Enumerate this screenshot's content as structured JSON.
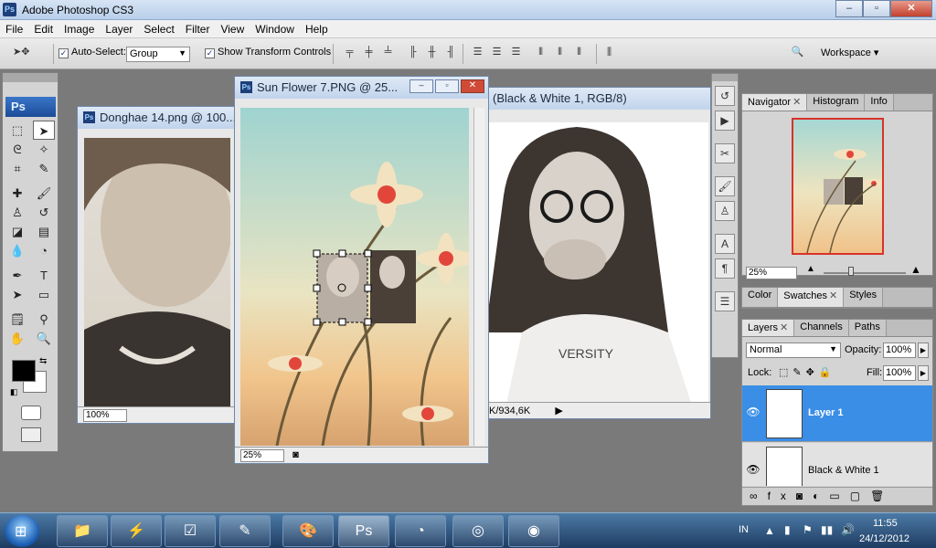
{
  "app": {
    "title": "Adobe Photoshop CS3",
    "icon_label": "Ps"
  },
  "window_buttons": {
    "minimize": "–",
    "maximize": "▫",
    "close": "✕"
  },
  "menu": [
    "File",
    "Edit",
    "Image",
    "Layer",
    "Select",
    "Filter",
    "View",
    "Window",
    "Help"
  ],
  "options_bar": {
    "auto_select_label": "Auto-Select:",
    "auto_select_value": "Group",
    "show_transform_label": "Show Transform Controls",
    "workspace_label": "Workspace ▾"
  },
  "tools": {
    "ps_logo": "Ps"
  },
  "documents": {
    "donghae": {
      "title": "Donghae 14.png @ 100...",
      "zoom": "100%"
    },
    "bw": {
      "title": "(Black & White 1, RGB/8)",
      "status": "K/934,6K"
    },
    "sunflower": {
      "title": "Sun Flower 7.PNG @ 25...",
      "zoom": "25%"
    }
  },
  "panels": {
    "navigator": {
      "tabs": [
        "Navigator",
        "Histogram",
        "Info"
      ],
      "zoom": "25%"
    },
    "color": {
      "tabs": [
        "Color",
        "Swatches",
        "Styles"
      ]
    },
    "layers": {
      "tabs": [
        "Layers",
        "Channels",
        "Paths"
      ],
      "blend_mode": "Normal",
      "opacity_label": "Opacity:",
      "opacity_value": "100%",
      "lock_label": "Lock:",
      "fill_label": "Fill:",
      "fill_value": "100%",
      "items": [
        {
          "name": "Layer 1",
          "selected": true
        },
        {
          "name": "Black & White 1",
          "selected": false
        }
      ]
    }
  },
  "taskbar": {
    "language": "IN",
    "time": "11:55",
    "date": "24/12/2012",
    "ps_task": "Ps"
  },
  "colors": {
    "selection_blue": "#3a8ee6",
    "foreground": "#000000",
    "background": "#ffffff"
  }
}
